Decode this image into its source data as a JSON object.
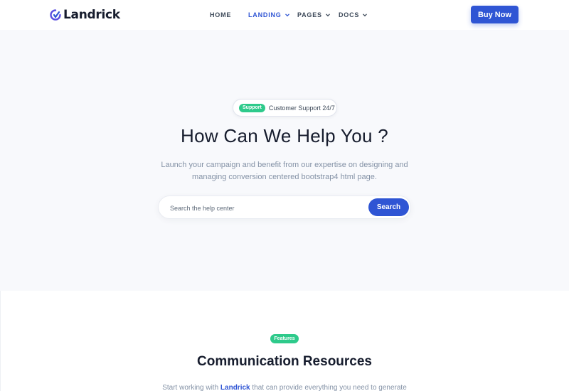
{
  "brand": {
    "name": "Landrick"
  },
  "nav": {
    "items": [
      {
        "label": "HOME",
        "active": false,
        "dropdown": false
      },
      {
        "label": "LANDING",
        "active": true,
        "dropdown": true
      },
      {
        "label": "PAGES",
        "active": false,
        "dropdown": true
      },
      {
        "label": "DOCS",
        "active": false,
        "dropdown": true
      }
    ],
    "cta_label": "Buy Now"
  },
  "hero": {
    "badge": "Support",
    "badge_text": "Customer Support 24/7",
    "title": "How Can We Help You ?",
    "description": "Launch your campaign and benefit from our expertise on designing and managing conversion centered bootstrap4 html page.",
    "search": {
      "placeholder": "Search the help center",
      "value": "",
      "button_label": "Search"
    }
  },
  "features": {
    "badge": "Features",
    "title": "Communication Resources",
    "desc_prefix": "Start working with",
    "desc_brand": "Landrick",
    "desc_suffix": "that can provide everything you need to generate"
  },
  "colors": {
    "primary": "#2f55d4",
    "success": "#2eca8b",
    "muted": "#8492a6",
    "hero_bg": "#f8f9fc"
  }
}
